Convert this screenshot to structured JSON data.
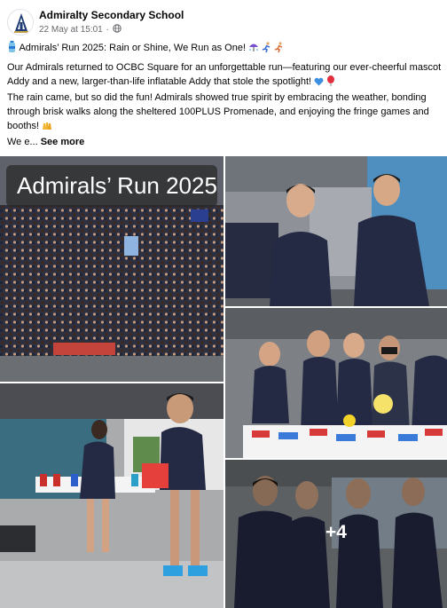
{
  "post": {
    "author": "Admiralty Secondary School",
    "date": "22 May at 15:01",
    "separator": "·",
    "privacy_icon": "globe-icon",
    "title_line": "Admirals’ Run 2025: Rain or Shine, We Run as One!",
    "para1": "Our Admirals returned to OCBC Square for an unforgettable run—featuring our ever-cheerful mascot Addy and a new, larger-than-life inflatable Addy that stole the spotlight!",
    "para2": "The rain came, but so did the fun! Admirals showed true spirit by embracing the weather, bonding through brisk walks along the sheltered 100PLUS Promenade, and enjoying the fringe games and booths!",
    "para3_start": "We e...",
    "see_more": "See more"
  },
  "photos": {
    "main_overlay": "Admirals’ Run 2025",
    "more_count": "+4"
  },
  "colors": {
    "text_primary": "#050505",
    "text_secondary": "#65676b",
    "shirt_navy": "#242a44"
  }
}
